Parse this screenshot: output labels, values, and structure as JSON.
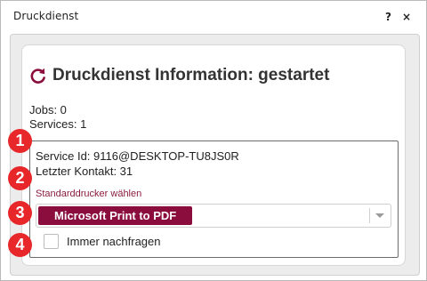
{
  "window": {
    "title": "Druckdienst",
    "help_label": "?",
    "close_label": "×"
  },
  "header": {
    "title": "Druckdienst Information: gestartet"
  },
  "stats": {
    "jobs": "Jobs: 0",
    "services": "Services: 1"
  },
  "service": {
    "id": "Service Id: 9116@DESKTOP-TU8JS0R",
    "last_contact": "Letzter Kontakt: 31",
    "default_printer_label": "Standarddrucker wählen",
    "default_printer_value": "Microsoft Print to PDF",
    "always_ask_label": "Immer nachfragen",
    "always_ask_checked": false
  },
  "markers": [
    "1",
    "2",
    "3",
    "4"
  ],
  "colors": {
    "accent": "#8b0d3d",
    "marker": "#e8272b",
    "label": "#8b1e3f"
  }
}
